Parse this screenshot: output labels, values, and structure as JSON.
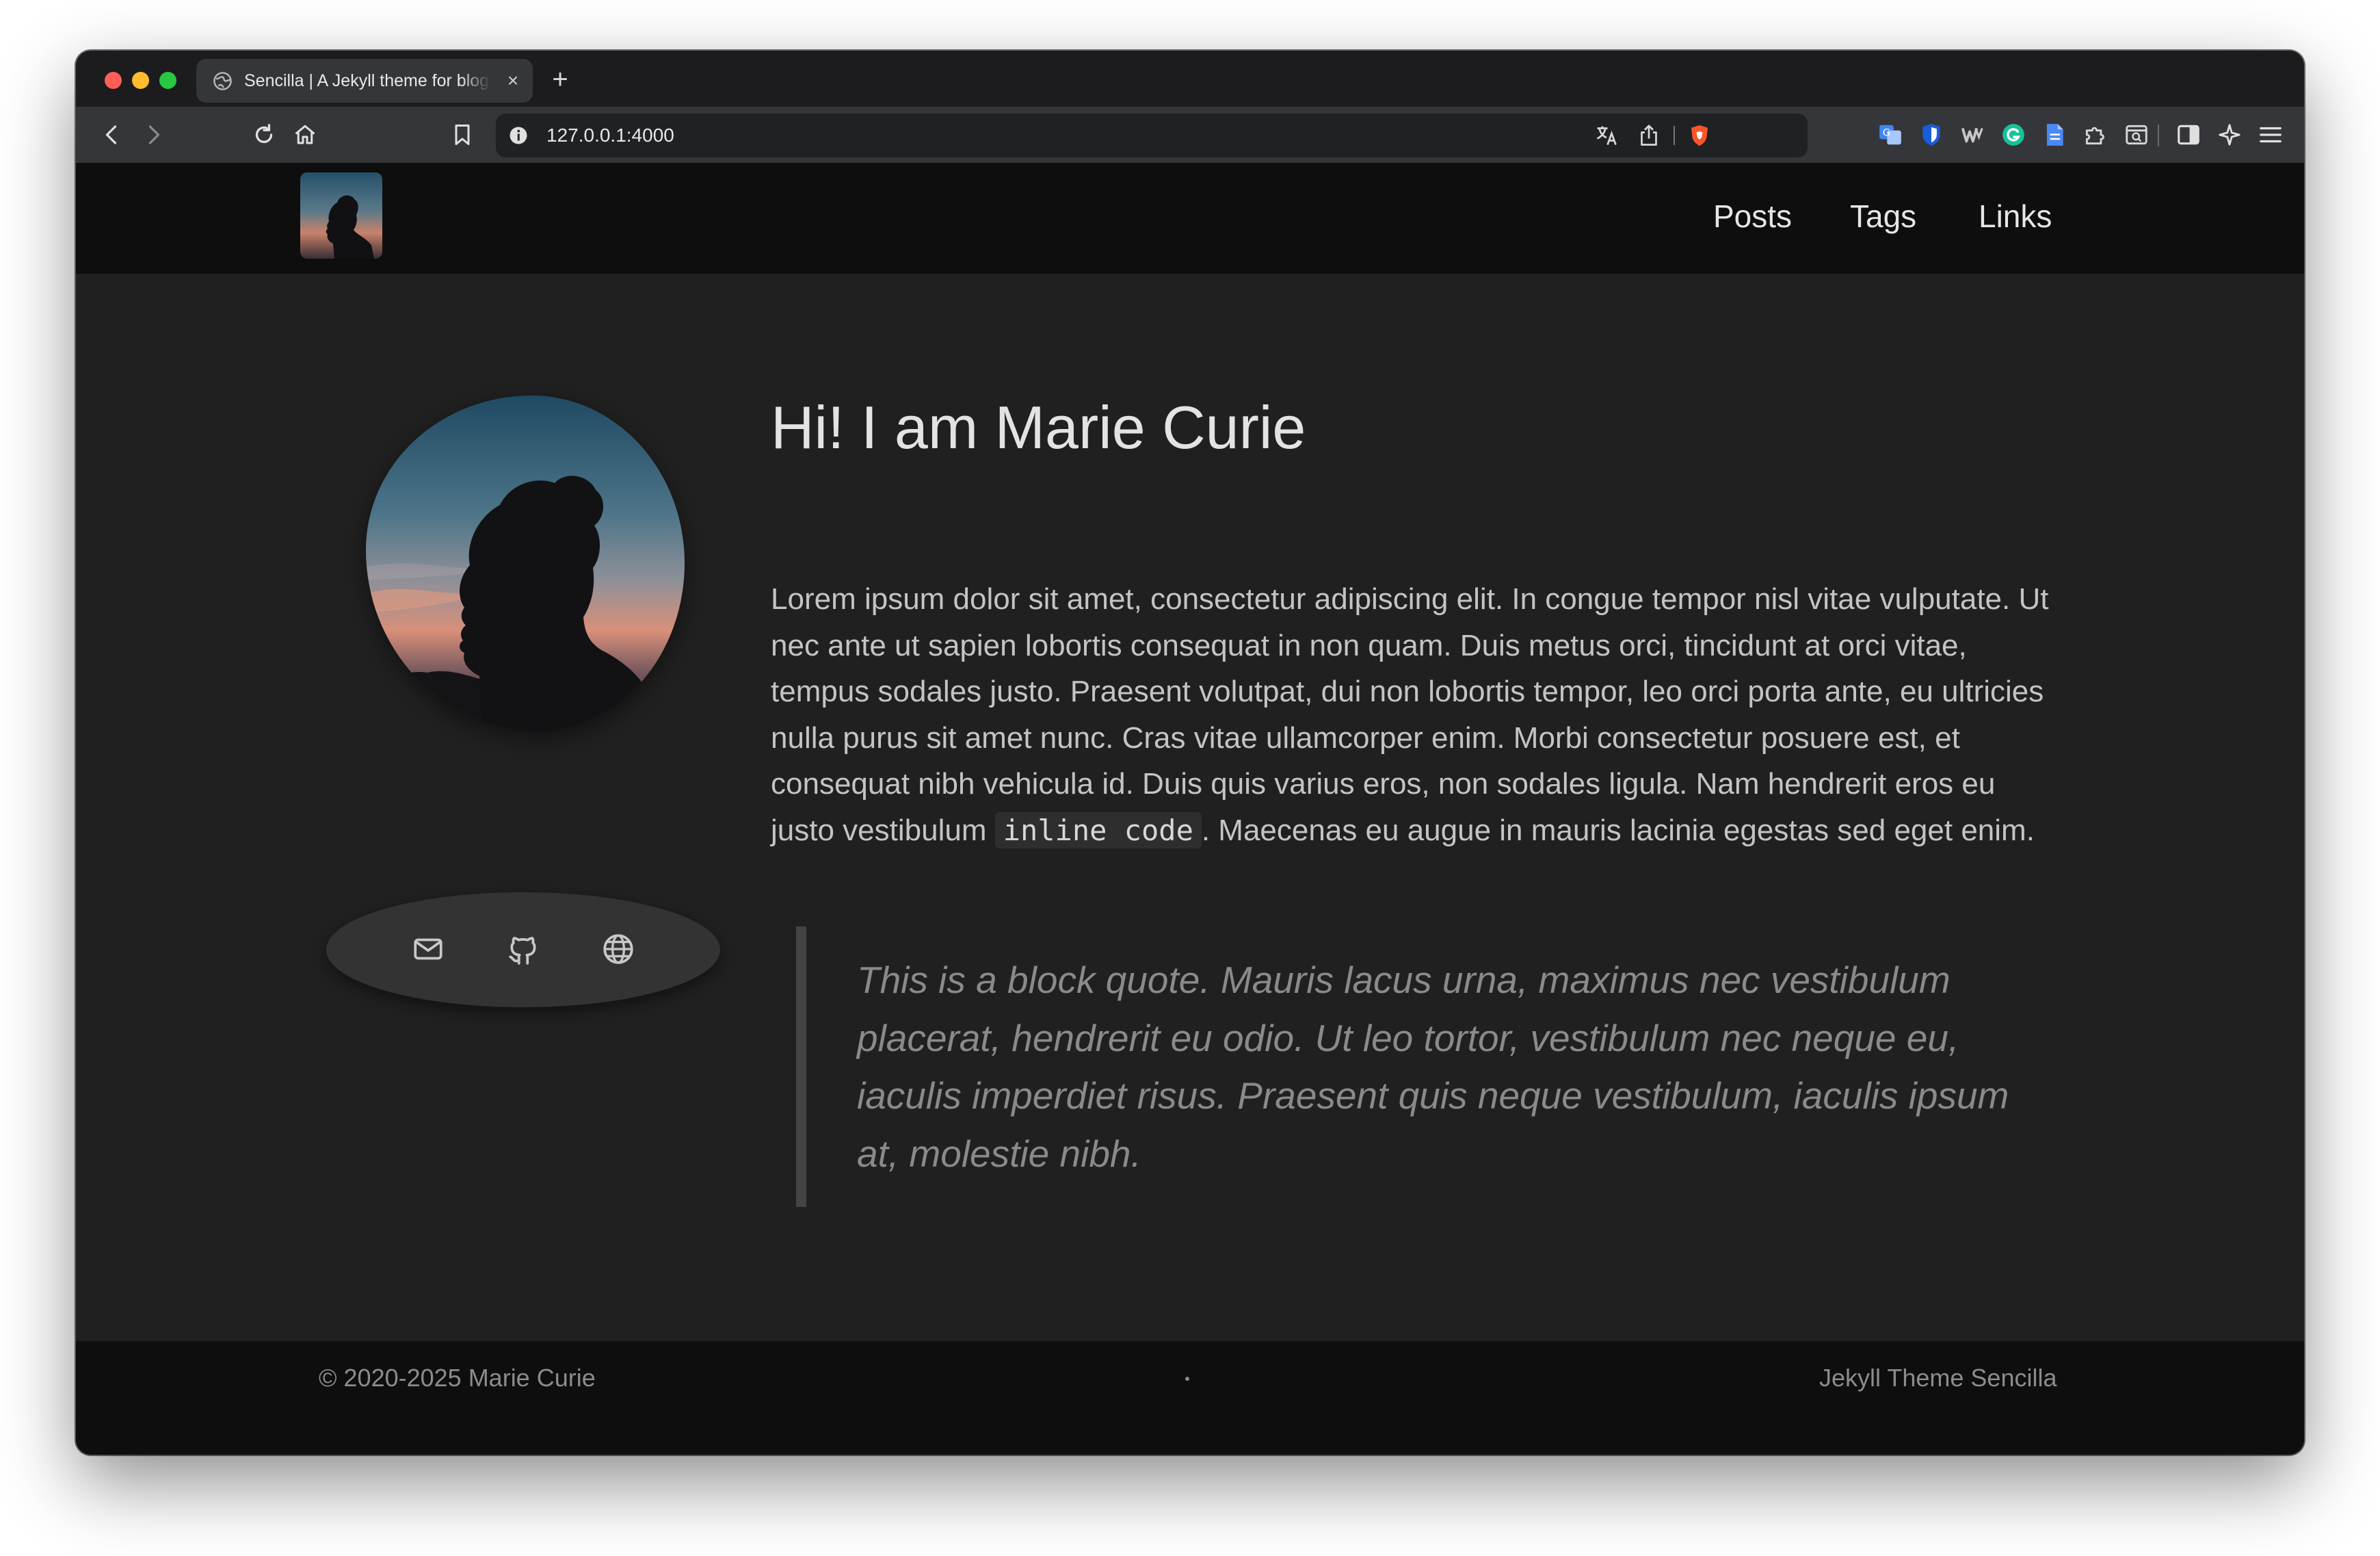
{
  "browser": {
    "tab_title": "Sencilla | A Jekyll theme for blogs",
    "tab_close": "×",
    "new_tab": "+",
    "url": "127.0.0.1:4000"
  },
  "site": {
    "nav": {
      "links": [
        "Posts",
        "Tags",
        "Links"
      ]
    },
    "hero": {
      "title": "Hi! I am Marie Curie",
      "intro_before_code": "Lorem ipsum dolor sit amet, consectetur adipiscing elit. In congue tempor nisl vitae vulputate. Ut nec ante ut sapien lobortis consequat in non quam. Duis metus orci, tincidunt at orci vitae, tempus sodales justo. Praesent volutpat, dui non lobortis tempor, leo orci porta ante, eu ultricies nulla purus sit amet nunc. Cras vitae ullamcorper enim. Morbi consectetur posuere est, et consequat nibh vehicula id. Duis quis varius eros, non sodales ligula. Nam hendrerit eros eu justo vestibulum ",
      "inline_code": "inline code",
      "intro_after_code": ". Maecenas eu augue in mauris lacinia egestas sed eget enim.",
      "blockquote": "This is a block quote. Mauris lacus urna, maximus nec vestibulum placerat, hendrerit eu odio. Ut leo tortor, vestibulum nec neque eu, iaculis imperdiet risus. Praesent quis neque vestibulum, iaculis ipsum at, molestie nibh."
    },
    "social_icons": [
      "email-icon",
      "github-icon",
      "globe-icon"
    ],
    "footer": {
      "copyright": "© 2020-2025 Marie Curie",
      "theme_credit": "Jekyll Theme Sencilla"
    }
  },
  "colors": {
    "page_bg": "#202020",
    "nav_bg": "#0e0e0e",
    "text": "#c4c4c4",
    "quote_text": "#8a8a8a",
    "quote_border": "#444444"
  }
}
